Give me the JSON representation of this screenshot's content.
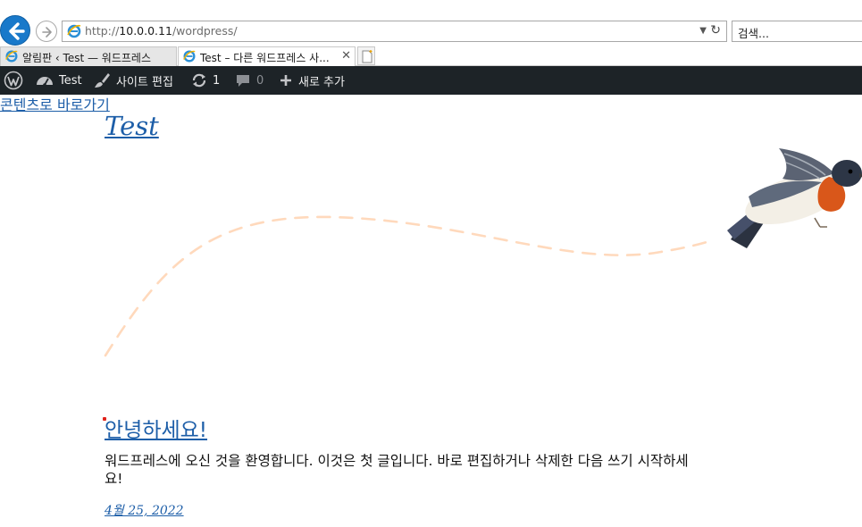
{
  "browser": {
    "address": {
      "url_prefix": "http://",
      "url_host": "10.0.0.11",
      "url_path": "/wordpress/",
      "dropdown_icon": "chevron-down-icon",
      "refresh_icon": "refresh-icon",
      "refresh_glyph": "↻"
    },
    "search": {
      "placeholder": "검색..."
    },
    "tabs": [
      {
        "label": "알림판 ‹ Test — 워드프레스",
        "active": false
      },
      {
        "label": "Test – 다른 워드프레스 사...",
        "active": true,
        "close": "✕"
      }
    ],
    "colors": {
      "back_button": "#1979ca"
    }
  },
  "adminbar": {
    "site_name": "Test",
    "customize": "사이트 편집",
    "updates_count": "1",
    "comments_count": "0",
    "new_content": "새로 추가",
    "background": "#1d2327"
  },
  "page": {
    "skip_link": "콘텐츠로 바로가기",
    "site_title": "Test",
    "post": {
      "title": "안녕하세요!",
      "body": "워드프레스에 오신 것을 환영합니다. 이것은 첫 글입니다. 바로 편집하거나 삭제한 다음 쓰기 시작하세요!",
      "date": "4월 25, 2022"
    },
    "link_color": "#1d5ea8"
  }
}
